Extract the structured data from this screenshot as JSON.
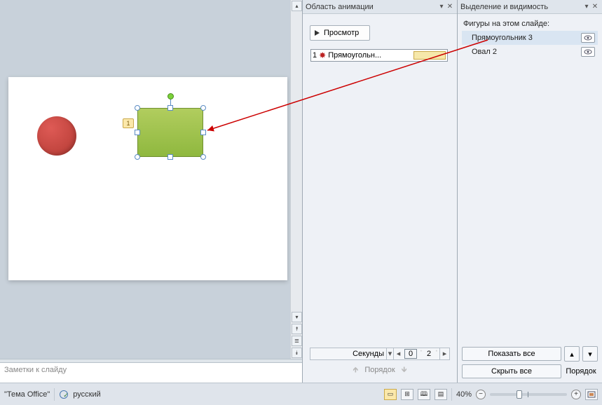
{
  "slide": {
    "shapes": {
      "circle": {
        "name": "Овал 2"
      },
      "rect": {
        "name": "Прямоугольник 3",
        "anim_index": "1"
      }
    }
  },
  "anim_pane": {
    "title": "Область анимации",
    "preview": "Просмотр",
    "item": {
      "index": "1",
      "name": "Прямоугольн..."
    },
    "seconds_label": "Секунды",
    "current": "0",
    "marker": "2",
    "order_label": "Порядок"
  },
  "sel_pane": {
    "title": "Выделение и видимость",
    "label": "Фигуры на этом слайде:",
    "items": [
      {
        "name": "Прямоугольник 3"
      },
      {
        "name": "Овал 2"
      }
    ],
    "show_all": "Показать все",
    "hide_all": "Скрыть все",
    "order_label": "Порядок"
  },
  "notes": {
    "placeholder": "Заметки к слайду"
  },
  "status": {
    "theme": "\"Тема Office\"",
    "lang": "русский",
    "zoom": "40%"
  }
}
